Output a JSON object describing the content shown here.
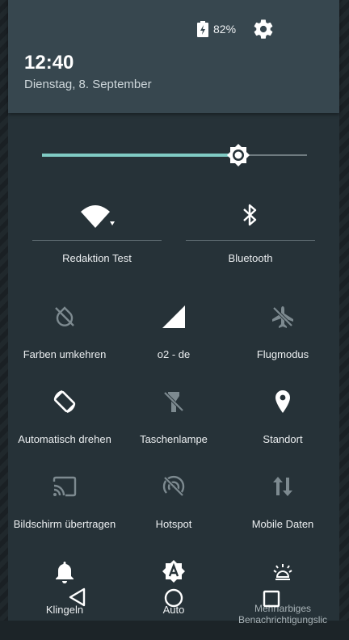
{
  "status_bar": {
    "battery_percent": "82%",
    "battery_icon": "battery-charging-icon",
    "settings_icon": "gear-icon"
  },
  "header": {
    "time": "12:40",
    "date": "Dienstag, 8. September"
  },
  "brightness": {
    "level_percent": 74,
    "icon": "brightness-thumb-icon"
  },
  "big_tiles": [
    {
      "label": "Redaktion Test",
      "icon": "wifi-icon"
    },
    {
      "label": "Bluetooth",
      "icon": "bluetooth-icon"
    }
  ],
  "tiles": [
    {
      "label": "Farben umkehren",
      "icon": "invert-colors-off-icon"
    },
    {
      "label": "o2 - de",
      "icon": "cell-signal-icon"
    },
    {
      "label": "Flugmodus",
      "icon": "airplane-off-icon"
    },
    {
      "label": "Automatisch drehen",
      "icon": "auto-rotate-icon"
    },
    {
      "label": "Taschenlampe",
      "icon": "flashlight-off-icon"
    },
    {
      "label": "Standort",
      "icon": "location-icon"
    },
    {
      "label": "Bildschirm übertragen",
      "icon": "cast-icon"
    },
    {
      "label": "Hotspot",
      "icon": "hotspot-off-icon"
    },
    {
      "label": "Mobile Daten",
      "icon": "mobile-data-icon"
    },
    {
      "label": "Klingeln",
      "icon": "bell-icon"
    },
    {
      "label": "Auto",
      "icon": "auto-brightness-icon"
    },
    {
      "label": "Mehrfarbiges Benachrichtigungslic",
      "icon": "notification-light-icon"
    }
  ],
  "navigation": {
    "back_icon": "back-icon",
    "home_icon": "home-icon",
    "recents_icon": "recents-icon"
  },
  "colors": {
    "accent": "#80cbc4",
    "panel": "#263238",
    "header": "#37474f"
  }
}
